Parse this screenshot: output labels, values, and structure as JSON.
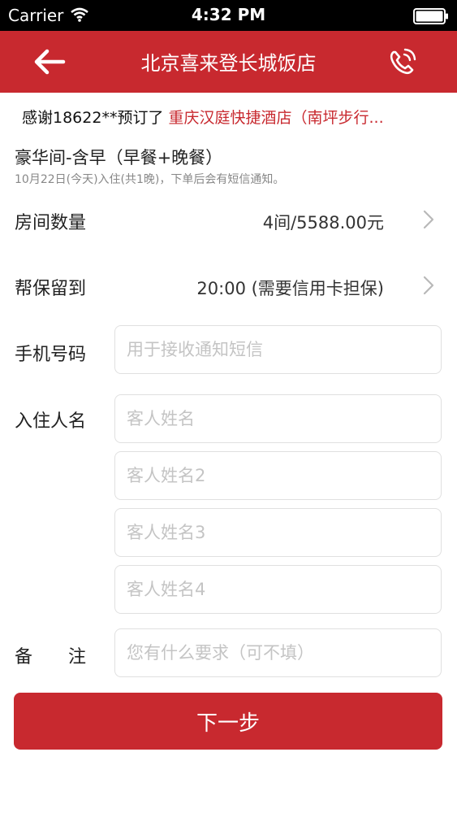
{
  "status_bar": {
    "carrier": "Carrier",
    "time": "4:32 PM"
  },
  "nav": {
    "title": "北京喜来登长城饭店",
    "back_icon": "arrow-left-icon",
    "phone_icon": "phone-icon"
  },
  "ticker": {
    "prefix": "感谢18622**预订了",
    "hotel": "重庆汉庭快捷酒店（南坪步行..."
  },
  "room": {
    "title": "豪华间-含早（早餐+晚餐）",
    "subtitle": "10月22日(今天)入住(共1晚)，下单后会有短信通知。"
  },
  "rows": {
    "room_count": {
      "label": "房间数量",
      "value": "4间/5588.00元"
    },
    "hold_until": {
      "label": "帮保留到",
      "value": "20:00 (需要信用卡担保)"
    }
  },
  "form": {
    "phone": {
      "label": "手机号码",
      "placeholder": "用于接收通知短信",
      "value": ""
    },
    "guests": {
      "label": "入住人名",
      "placeholders": [
        "客人姓名",
        "客人姓名2",
        "客人姓名3",
        "客人姓名4"
      ]
    },
    "remarks": {
      "label": "备　　注",
      "placeholder": "您有什么要求（可不填）"
    }
  },
  "next_button": {
    "label": "下一步"
  },
  "colors": {
    "brand_red": "#c8292f",
    "placeholder": "#c4c4c4",
    "border": "#e0e0e0"
  }
}
